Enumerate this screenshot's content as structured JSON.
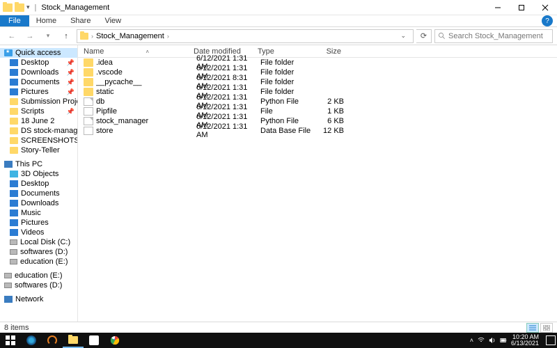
{
  "titlebar": {
    "title": "Stock_Management"
  },
  "ribbon": {
    "file": "File",
    "home": "Home",
    "share": "Share",
    "view": "View"
  },
  "breadcrumb": {
    "root": "Stock_Management"
  },
  "search": {
    "placeholder": "Search Stock_Management"
  },
  "sidebar": {
    "quick": "Quick access",
    "quick_items": [
      {
        "label": "Desktop",
        "icon": "ico-desktop",
        "pin": true
      },
      {
        "label": "Downloads",
        "icon": "ico-downloads",
        "pin": true
      },
      {
        "label": "Documents",
        "icon": "ico-docs",
        "pin": true
      },
      {
        "label": "Pictures",
        "icon": "ico-pics",
        "pin": true
      },
      {
        "label": "Submission Projects",
        "icon": "ico-folder",
        "pin": true
      },
      {
        "label": "Scripts",
        "icon": "ico-folder",
        "pin": true
      },
      {
        "label": "18 June 2",
        "icon": "ico-folder",
        "pin": false
      },
      {
        "label": "DS stock-management",
        "icon": "ico-folder",
        "pin": false
      },
      {
        "label": "SCREENSHOTS",
        "icon": "ico-folder",
        "pin": false
      },
      {
        "label": "Story-Teller",
        "icon": "ico-folder",
        "pin": false
      }
    ],
    "thispc": "This PC",
    "pc_items": [
      {
        "label": "3D Objects",
        "icon": "ico-3d"
      },
      {
        "label": "Desktop",
        "icon": "ico-desktop"
      },
      {
        "label": "Documents",
        "icon": "ico-docs"
      },
      {
        "label": "Downloads",
        "icon": "ico-downloads"
      },
      {
        "label": "Music",
        "icon": "ico-music"
      },
      {
        "label": "Pictures",
        "icon": "ico-pics"
      },
      {
        "label": "Videos",
        "icon": "ico-videos"
      },
      {
        "label": "Local Disk (C:)",
        "icon": "ico-disk"
      },
      {
        "label": "softwares (D:)",
        "icon": "ico-disk"
      },
      {
        "label": "education (E:)",
        "icon": "ico-disk"
      }
    ],
    "extra": [
      {
        "label": "education (E:)",
        "icon": "ico-disk"
      },
      {
        "label": "softwares (D:)",
        "icon": "ico-disk"
      }
    ],
    "network": "Network"
  },
  "columns": {
    "name": "Name",
    "date": "Date modified",
    "type": "Type",
    "size": "Size"
  },
  "files": [
    {
      "name": ".idea",
      "date": "6/12/2021 1:31 AM",
      "type": "File folder",
      "size": "",
      "ic": "ic-folder"
    },
    {
      "name": ".vscode",
      "date": "6/12/2021 1:31 AM",
      "type": "File folder",
      "size": "",
      "ic": "ic-folder"
    },
    {
      "name": "__pycache__",
      "date": "6/12/2021 8:31 AM",
      "type": "File folder",
      "size": "",
      "ic": "ic-folder"
    },
    {
      "name": "static",
      "date": "6/12/2021 1:31 AM",
      "type": "File folder",
      "size": "",
      "ic": "ic-folder"
    },
    {
      "name": "db",
      "date": "6/12/2021 1:31 AM",
      "type": "Python File",
      "size": "2 KB",
      "ic": "ic-py"
    },
    {
      "name": "Pipfile",
      "date": "6/12/2021 1:31 AM",
      "type": "File",
      "size": "1 KB",
      "ic": "ic-file"
    },
    {
      "name": "stock_manager",
      "date": "6/12/2021 1:31 AM",
      "type": "Python File",
      "size": "6 KB",
      "ic": "ic-py"
    },
    {
      "name": "store",
      "date": "6/12/2021 1:31 AM",
      "type": "Data Base File",
      "size": "12 KB",
      "ic": "ic-db"
    }
  ],
  "status": {
    "count": "8 items"
  },
  "tray": {
    "time": "10:20 AM",
    "date": "6/13/2021"
  }
}
